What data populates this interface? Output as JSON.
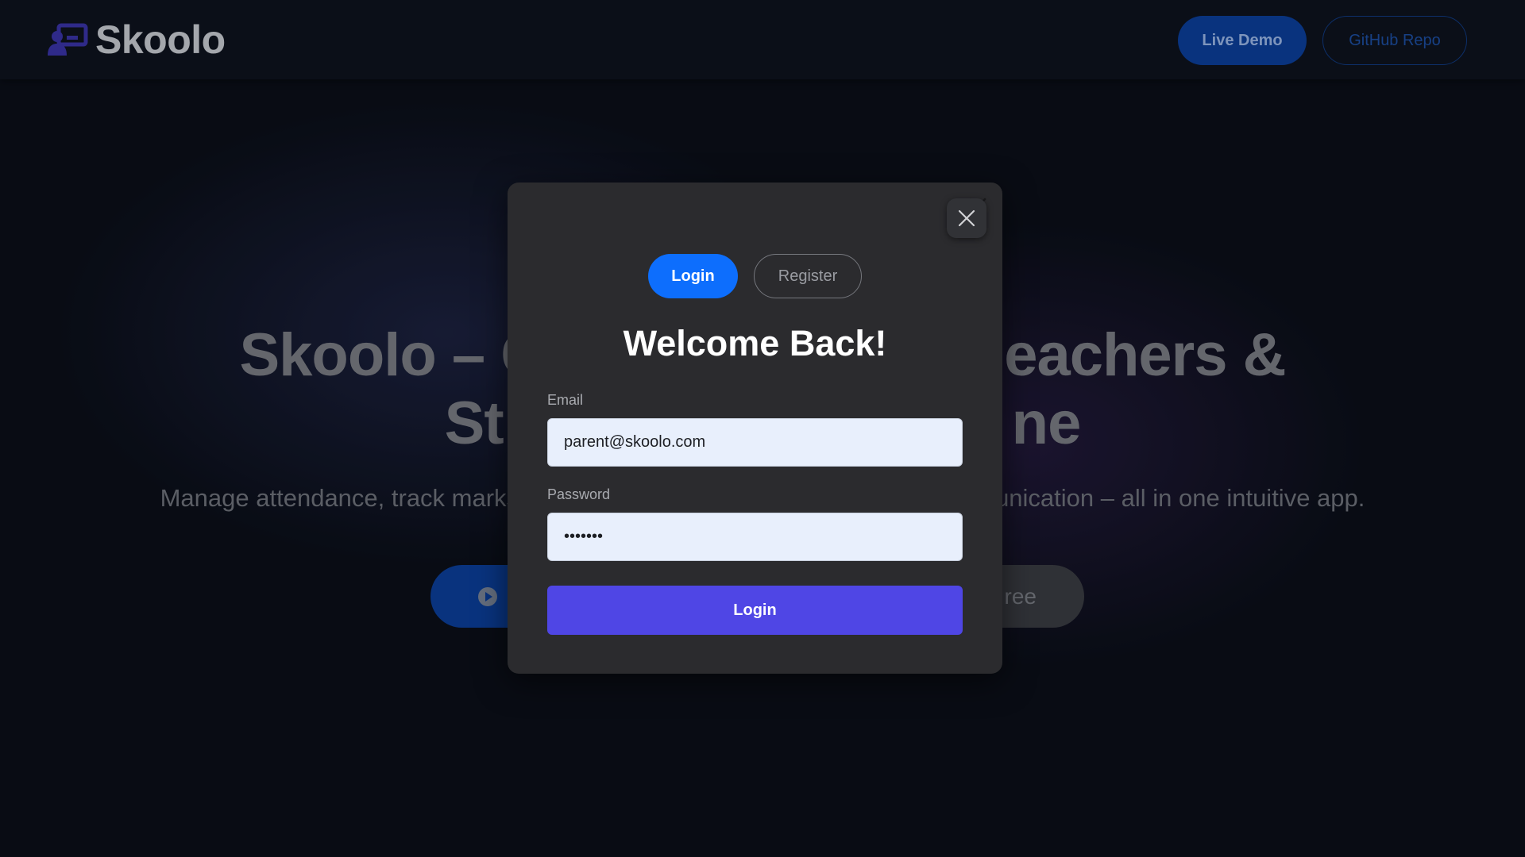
{
  "header": {
    "brand_name": "Skoolo",
    "live_demo_label": "Live Demo",
    "github_label": "GitHub Repo"
  },
  "hero": {
    "title_line1_left": "Skoolo – C",
    "title_line1_right": "eachers &",
    "title_line2_left": "St",
    "title_line2_right": "ne",
    "subtitle_left": "Manage attendance, track marks",
    "subtitle_right": "unication – all in one intuitive app.",
    "free_button_label": "ree"
  },
  "modal": {
    "tabs": [
      {
        "label": "Login",
        "active": true
      },
      {
        "label": "Register",
        "active": false
      }
    ],
    "title": "Welcome Back!",
    "email": {
      "label": "Email",
      "value": "parent@skoolo.com"
    },
    "password": {
      "label": "Password",
      "value": "•••••••"
    },
    "submit_label": "Login"
  },
  "colors": {
    "primary_blue": "#0d6efd",
    "submit_indigo": "#4f46e5",
    "modal_bg": "#2b2b2e",
    "input_bg": "#e8effc"
  },
  "icons": {
    "brand": "teacher-board-icon",
    "close": "close-icon",
    "play": "play-circle-icon"
  }
}
